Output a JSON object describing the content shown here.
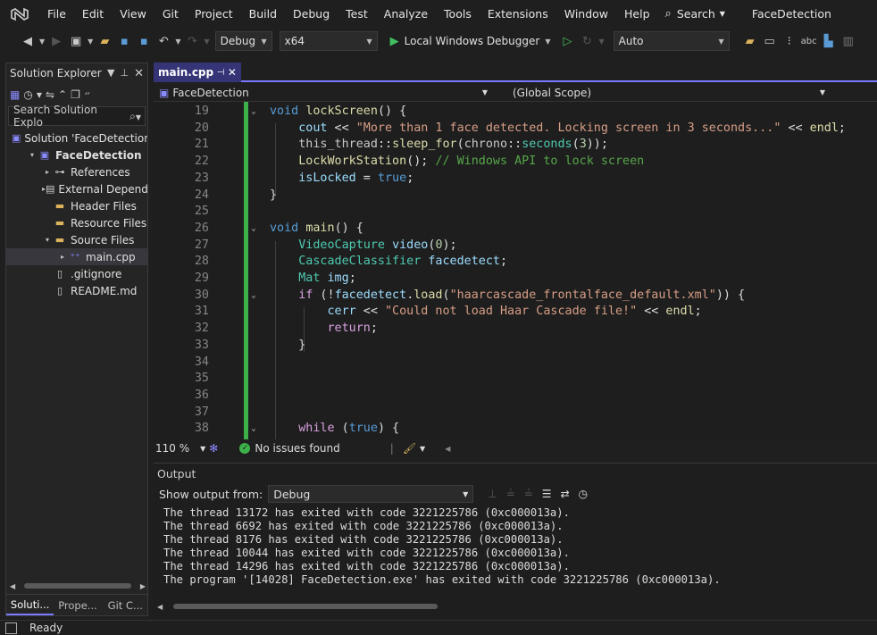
{
  "colors": {
    "accent": "#7979ff",
    "change_bar": "#3cb14a",
    "run_green": "#3fbf5f",
    "background": "#1f1f1f",
    "editor_bg": "#1e1e1e"
  },
  "menu": {
    "items": [
      "File",
      "Edit",
      "View",
      "Git",
      "Project",
      "Build",
      "Debug",
      "Test",
      "Analyze",
      "Tools",
      "Extensions",
      "Window",
      "Help"
    ],
    "search_label": "Search",
    "solution_title": "FaceDetection"
  },
  "toolbar": {
    "configuration": "Debug",
    "platform": "x64",
    "run_label": "Local Windows Debugger",
    "auto_combo": "Auto"
  },
  "solution_explorer": {
    "title": "Solution Explorer",
    "search_placeholder": "Search Solution Explo",
    "tree": [
      {
        "label": "Solution 'FaceDetection",
        "indent": 0,
        "expander": "",
        "icon": "solution-icon",
        "bold": false,
        "selected": false
      },
      {
        "label": "FaceDetection",
        "indent": 1,
        "expander": "▾",
        "icon": "project-icon",
        "bold": true,
        "selected": false
      },
      {
        "label": "References",
        "indent": 2,
        "expander": "▸",
        "icon": "references-icon",
        "bold": false,
        "selected": false
      },
      {
        "label": "External Depend",
        "indent": 2,
        "expander": "▸",
        "icon": "external-deps-icon",
        "bold": false,
        "selected": false
      },
      {
        "label": "Header Files",
        "indent": 2,
        "expander": "",
        "icon": "folder-icon",
        "bold": false,
        "selected": false
      },
      {
        "label": "Resource Files",
        "indent": 2,
        "expander": "",
        "icon": "folder-icon",
        "bold": false,
        "selected": false
      },
      {
        "label": "Source Files",
        "indent": 2,
        "expander": "▾",
        "icon": "folder-open-icon",
        "bold": false,
        "selected": false
      },
      {
        "label": "main.cpp",
        "indent": 3,
        "expander": "▸",
        "icon": "cpp-file-icon",
        "bold": false,
        "selected": true
      },
      {
        "label": ".gitignore",
        "indent": 2,
        "expander": "",
        "icon": "file-icon",
        "bold": false,
        "selected": false
      },
      {
        "label": "README.md",
        "indent": 2,
        "expander": "",
        "icon": "file-icon",
        "bold": false,
        "selected": false
      }
    ],
    "bottom_tabs": [
      "Soluti...",
      "Prope...",
      "Git C..."
    ]
  },
  "editor": {
    "tab_label": "main.cpp",
    "nav_project": "FaceDetection",
    "nav_scope": "(Global Scope)",
    "zoom": "110 %",
    "issues": "No issues found",
    "lines": [
      {
        "n": "19",
        "fold": "⌄",
        "code": [
          [
            "kw",
            "void "
          ],
          [
            "fn",
            "lockScreen"
          ],
          [
            "",
            "() {"
          ]
        ]
      },
      {
        "n": "20",
        "fold": "",
        "code": [
          [
            "",
            "    "
          ],
          [
            "vr",
            "cout"
          ],
          [
            "",
            " << "
          ],
          [
            "str",
            "\"More than 1 face detected. Locking screen in 3 seconds...\""
          ],
          [
            "",
            " << "
          ],
          [
            "fn",
            "endl"
          ],
          [
            "",
            ";"
          ]
        ]
      },
      {
        "n": "21",
        "fold": "",
        "code": [
          [
            "",
            "    "
          ],
          [
            "ns",
            "this_thread"
          ],
          [
            "",
            "::"
          ],
          [
            "fn",
            "sleep_for"
          ],
          [
            "",
            "("
          ],
          [
            "ns",
            "chrono"
          ],
          [
            "",
            "::"
          ],
          [
            "ty",
            "seconds"
          ],
          [
            "",
            "("
          ],
          [
            "num",
            "3"
          ],
          [
            "",
            "));"
          ]
        ]
      },
      {
        "n": "22",
        "fold": "",
        "code": [
          [
            "",
            "    "
          ],
          [
            "fn",
            "LockWorkStation"
          ],
          [
            "",
            "(); "
          ],
          [
            "cm",
            "// Windows API to lock screen"
          ]
        ]
      },
      {
        "n": "23",
        "fold": "",
        "code": [
          [
            "",
            "    "
          ],
          [
            "vr",
            "isLocked"
          ],
          [
            "",
            " = "
          ],
          [
            "kw",
            "true"
          ],
          [
            "",
            ";"
          ]
        ]
      },
      {
        "n": "24",
        "fold": "",
        "code": [
          [
            "",
            "}"
          ]
        ]
      },
      {
        "n": "25",
        "fold": "",
        "code": []
      },
      {
        "n": "26",
        "fold": "⌄",
        "code": [
          [
            "kw",
            "void "
          ],
          [
            "fn",
            "main"
          ],
          [
            "",
            "() {"
          ]
        ]
      },
      {
        "n": "27",
        "fold": "",
        "code": [
          [
            "",
            "    "
          ],
          [
            "ty",
            "VideoCapture "
          ],
          [
            "vr",
            "video"
          ],
          [
            "",
            "("
          ],
          [
            "num",
            "0"
          ],
          [
            "",
            ");"
          ]
        ]
      },
      {
        "n": "28",
        "fold": "",
        "code": [
          [
            "",
            "    "
          ],
          [
            "ty",
            "CascadeClassifier "
          ],
          [
            "vr",
            "facedetect"
          ],
          [
            "",
            ";"
          ]
        ]
      },
      {
        "n": "29",
        "fold": "",
        "code": [
          [
            "",
            "    "
          ],
          [
            "ty",
            "Mat "
          ],
          [
            "vr",
            "img"
          ],
          [
            "",
            ";"
          ]
        ]
      },
      {
        "n": "30",
        "fold": "⌄",
        "code": [
          [
            "",
            "    "
          ],
          [
            "ctl",
            "if"
          ],
          [
            "",
            " (!"
          ],
          [
            "vr",
            "facedetect"
          ],
          [
            "",
            "."
          ],
          [
            "fn",
            "load"
          ],
          [
            "",
            "("
          ],
          [
            "str",
            "\"haarcascade_frontalface_default.xml\""
          ],
          [
            "",
            ")) {"
          ]
        ]
      },
      {
        "n": "31",
        "fold": "",
        "code": [
          [
            "",
            "        "
          ],
          [
            "vr",
            "cerr"
          ],
          [
            "",
            " << "
          ],
          [
            "str",
            "\"Could not load Haar Cascade file!\""
          ],
          [
            "",
            " << "
          ],
          [
            "fn",
            "endl"
          ],
          [
            "",
            ";"
          ]
        ]
      },
      {
        "n": "32",
        "fold": "",
        "code": [
          [
            "",
            "        "
          ],
          [
            "ctl",
            "return"
          ],
          [
            "",
            ";"
          ]
        ]
      },
      {
        "n": "33",
        "fold": "",
        "code": [
          [
            "",
            "    }"
          ]
        ]
      },
      {
        "n": "34",
        "fold": "",
        "code": []
      },
      {
        "n": "35",
        "fold": "",
        "code": []
      },
      {
        "n": "36",
        "fold": "",
        "code": []
      },
      {
        "n": "37",
        "fold": "",
        "code": []
      },
      {
        "n": "38",
        "fold": "⌄",
        "code": [
          [
            "",
            "    "
          ],
          [
            "ctl",
            "while"
          ],
          [
            "",
            " ("
          ],
          [
            "kw",
            "true"
          ],
          [
            "",
            ") {"
          ]
        ]
      }
    ]
  },
  "output": {
    "title": "Output",
    "show_from_label": "Show output from:",
    "source": "Debug",
    "lines": [
      "The thread 13172 has exited with code 3221225786 (0xc000013a).",
      "The thread 6692 has exited with code 3221225786 (0xc000013a).",
      "The thread 8176 has exited with code 3221225786 (0xc000013a).",
      "The thread 10044 has exited with code 3221225786 (0xc000013a).",
      "The thread 14296 has exited with code 3221225786 (0xc000013a).",
      "The program '[14028] FaceDetection.exe' has exited with code 3221225786 (0xc000013a)."
    ]
  },
  "status": {
    "text": "Ready"
  }
}
